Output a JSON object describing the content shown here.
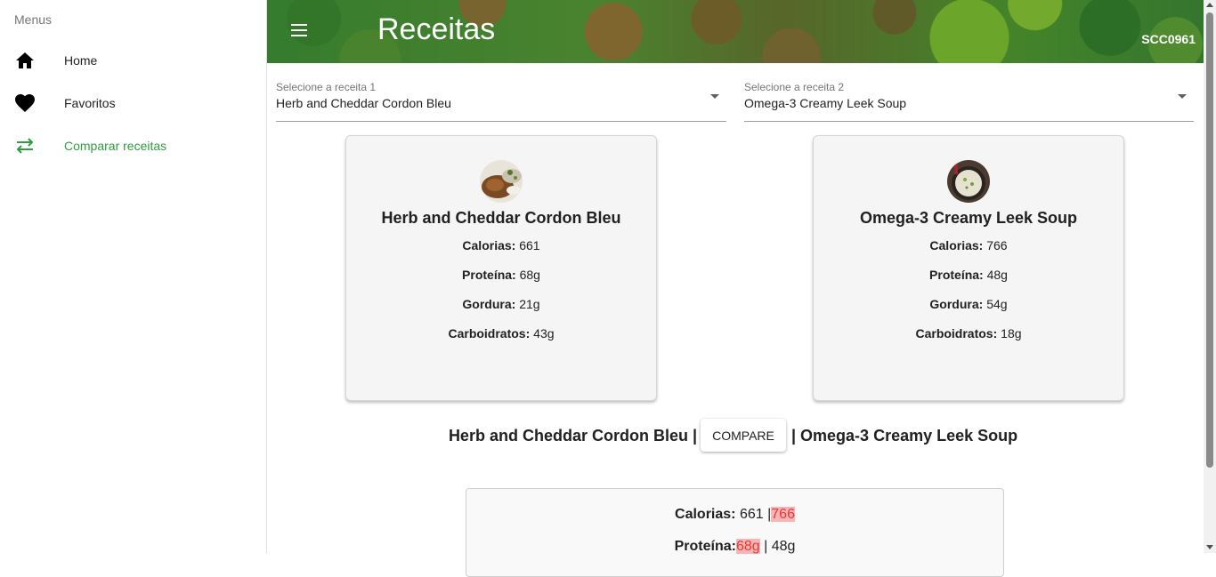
{
  "sidebar": {
    "title": "Menus",
    "items": [
      {
        "label": "Home",
        "icon": "home-icon"
      },
      {
        "label": "Favoritos",
        "icon": "heart-icon"
      },
      {
        "label": "Comparar receitas",
        "icon": "swap-icon"
      }
    ],
    "active_color": "#2e9e3e"
  },
  "header": {
    "title": "Receitas",
    "code": "SCC0961"
  },
  "selects": [
    {
      "label": "Selecione a receita 1",
      "value": "Herb and Cheddar Cordon Bleu"
    },
    {
      "label": "Selecione a receita 2",
      "value": "Omega-3 Creamy Leek Soup"
    }
  ],
  "cards": [
    {
      "name": "Herb and Cheddar Cordon Bleu",
      "rows": [
        {
          "key": "Calorias:",
          "value": "661"
        },
        {
          "key": "Proteína:",
          "value": "68g"
        },
        {
          "key": "Gordura:",
          "value": "21g"
        },
        {
          "key": "Carboidratos:",
          "value": "43g"
        }
      ]
    },
    {
      "name": "Omega-3 Creamy Leek Soup",
      "rows": [
        {
          "key": "Calorias:",
          "value": "766"
        },
        {
          "key": "Proteína:",
          "value": "48g"
        },
        {
          "key": "Gordura:",
          "value": "54g"
        },
        {
          "key": "Carboidratos:",
          "value": "18g"
        }
      ]
    }
  ],
  "compare": {
    "left": "Herb and Cheddar Cordon Bleu |",
    "button": "COMPARE",
    "right": "| Omega-3 Creamy Leek Soup"
  },
  "result": {
    "calorias": {
      "key": "Calorias:",
      "left": "661",
      "sep": "|",
      "right": "766"
    },
    "proteina": {
      "key": "Proteína:",
      "left": "68g",
      "sep": "|",
      "right": "48g"
    }
  },
  "colors": {
    "highlight_bg": "#f8b5b5",
    "highlight_text": "#e53935"
  }
}
